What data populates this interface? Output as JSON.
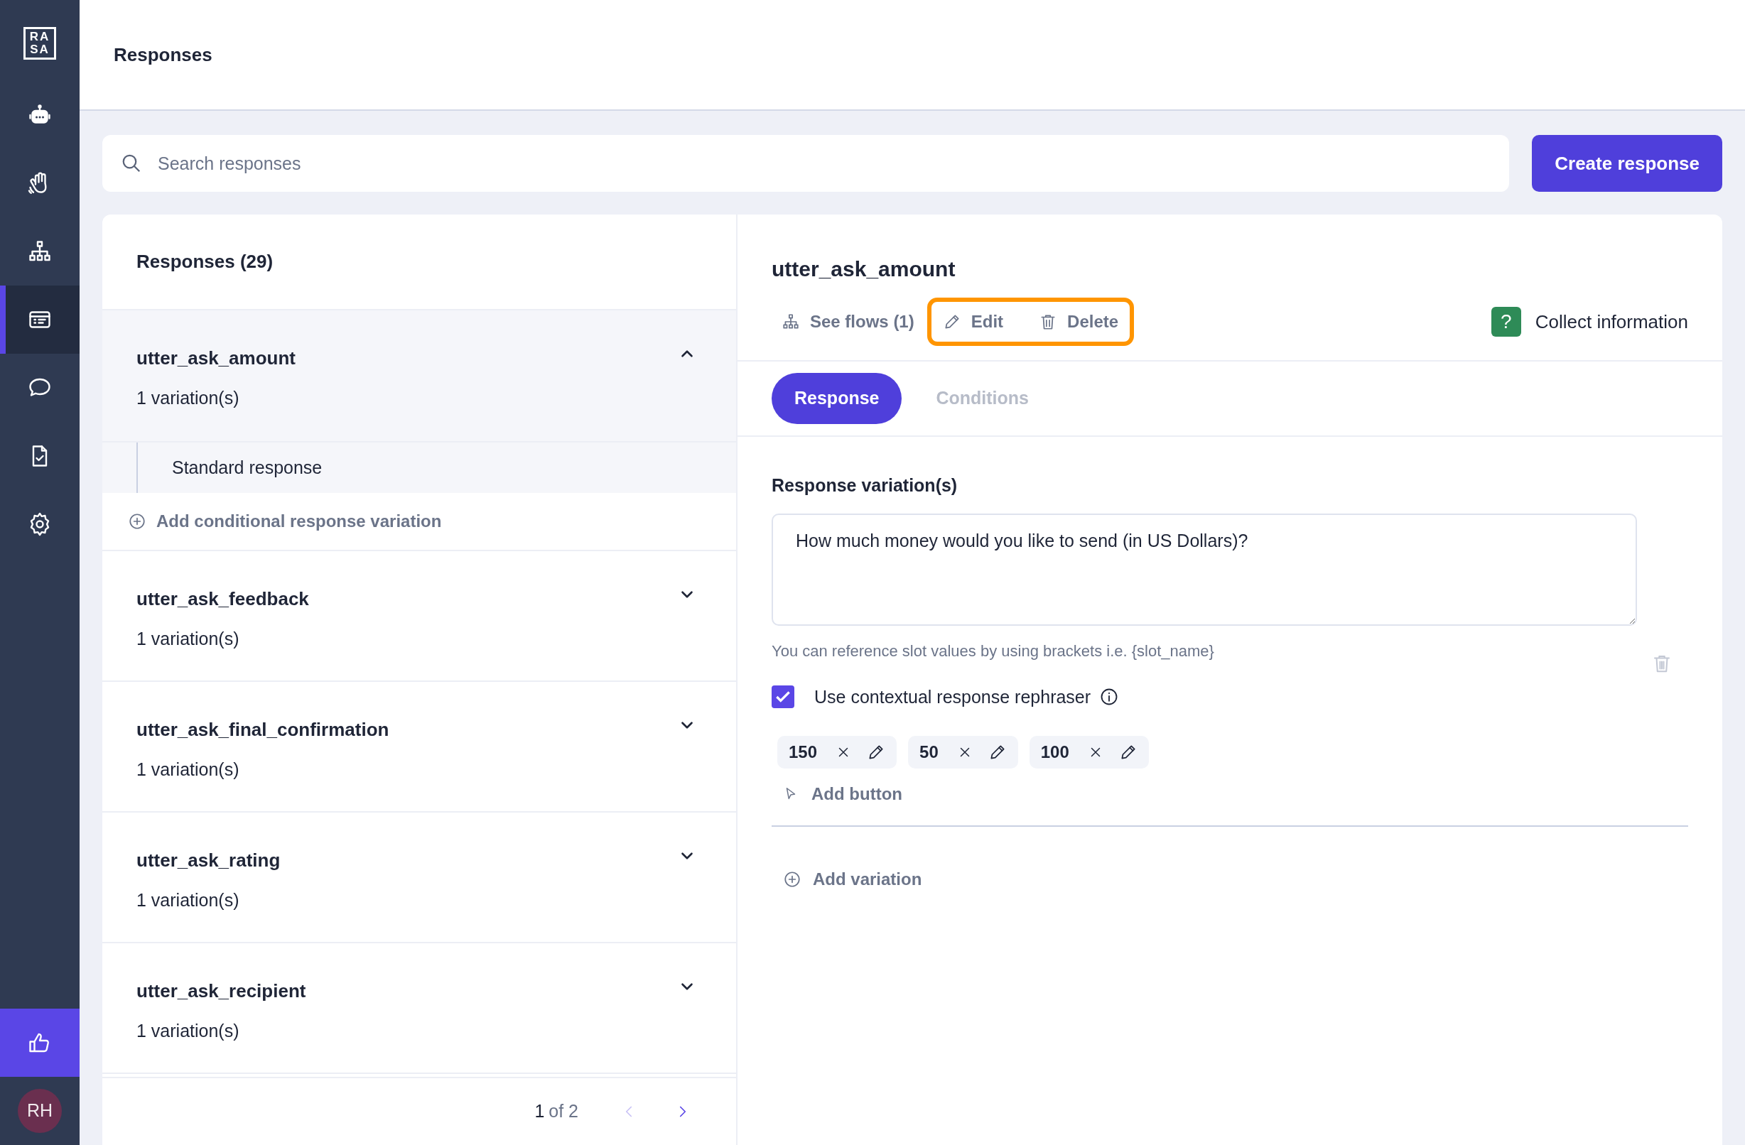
{
  "sidebar": {
    "logo_lines": [
      "RA",
      "SA"
    ],
    "items": [
      {
        "kind": "bot",
        "selected": false
      },
      {
        "kind": "hand",
        "selected": false
      },
      {
        "kind": "flows",
        "selected": false
      },
      {
        "kind": "responses",
        "selected": true
      },
      {
        "kind": "chat",
        "selected": false
      },
      {
        "kind": "document",
        "selected": false
      },
      {
        "kind": "settings",
        "selected": false
      }
    ],
    "avatar": "RH"
  },
  "header": {
    "title": "Responses"
  },
  "search": {
    "placeholder": "Search responses"
  },
  "create_button": "Create response",
  "list": {
    "title": "Responses (29)",
    "items": [
      {
        "name": "utter_ask_amount",
        "variations": "1 variation(s)",
        "expanded": true,
        "children": [
          {
            "label": "Standard response",
            "selected": true
          }
        ],
        "add_link": "Add conditional response variation"
      },
      {
        "name": "utter_ask_feedback",
        "variations": "1 variation(s)",
        "expanded": false
      },
      {
        "name": "utter_ask_final_confirmation",
        "variations": "1 variation(s)",
        "expanded": false
      },
      {
        "name": "utter_ask_rating",
        "variations": "1 variation(s)",
        "expanded": false
      },
      {
        "name": "utter_ask_recipient",
        "variations": "1 variation(s)",
        "expanded": false
      }
    ],
    "pagination": {
      "current": "1",
      "of": "of 2",
      "prev_disabled": true,
      "next_disabled": false
    }
  },
  "detail": {
    "title": "utter_ask_amount",
    "actions": [
      {
        "kind": "flows",
        "label": "See flows (1)",
        "highlighted": false
      },
      {
        "kind": "edit",
        "label": "Edit",
        "highlighted": true
      },
      {
        "kind": "delete",
        "label": "Delete",
        "highlighted": true
      }
    ],
    "badge": {
      "icon": "?",
      "label": "Collect information",
      "color": "#2e8b57"
    },
    "tabs": [
      {
        "label": "Response",
        "selected": true
      },
      {
        "label": "Conditions",
        "selected": false
      }
    ],
    "section_label": "Response variation(s)",
    "variation_text": "How much money would you like to send (in US Dollars)?",
    "hint": "You can reference slot values by using brackets i.e. {slot_name}",
    "rephraser": {
      "label": "Use contextual response rephraser",
      "checked": true
    },
    "buttons": [
      "150",
      "50",
      "100"
    ],
    "add_button": "Add button",
    "add_variation": "Add variation"
  }
}
